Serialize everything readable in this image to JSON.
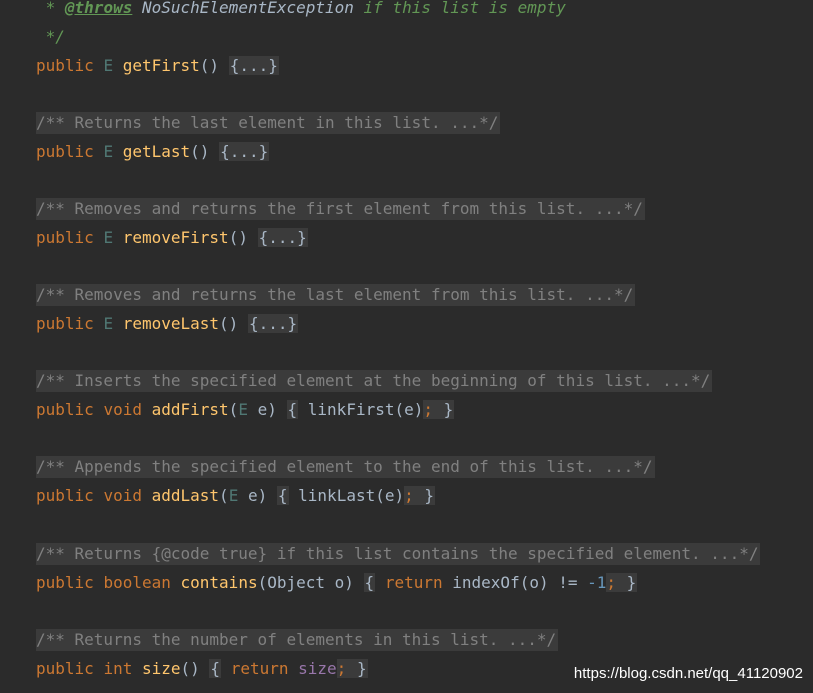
{
  "header_comment": {
    "star": " * ",
    "tag": "@throws",
    "exception": "NoSuchElementException",
    "rest": " if this list is empty",
    "close": " */"
  },
  "methods": [
    {
      "doc": null,
      "modifier": "public",
      "ret": "E",
      "name": "getFirst",
      "params_open": "(",
      "params": "",
      "params_close": ")",
      "body": "{...}"
    }
  ],
  "docs": {
    "getLast": "/** Returns the last element in this list. ...*/",
    "removeFirst": "/** Removes and returns the first element from this list. ...*/",
    "removeLast": "/** Removes and returns the last element from this list. ...*/",
    "addFirst": "/** Inserts the specified element at the beginning of this list. ...*/",
    "addLast": "/** Appends the specified element to the end of this list. ...*/",
    "contains": "/** Returns {@code true} if this list contains the specified element. ...*/",
    "size": "/** Returns the number of elements in this list. ...*/"
  },
  "code": {
    "public": "public",
    "E": "E",
    "void": "void",
    "boolean": "boolean",
    "int": "int",
    "getFirst": "getFirst",
    "getLast": "getLast",
    "removeFirst": "removeFirst",
    "removeLast": "removeLast",
    "addFirst": "addFirst",
    "addLast": "addLast",
    "contains": "contains",
    "size": "size",
    "folded": "{...}",
    "param_e": "E",
    "e": " e)",
    "open_brace": "{",
    "close_brace": "}",
    "linkFirst": "linkFirst(e)",
    "linkLast": "linkLast(e)",
    "semi": ";",
    "object_param": "(Object o)",
    "return": "return",
    "indexOf": "indexOf(o) != ",
    "minus_one": "-1",
    "size_field": "size",
    "empty_parens": "()"
  },
  "watermark": "https://blog.csdn.net/qq_41120902"
}
